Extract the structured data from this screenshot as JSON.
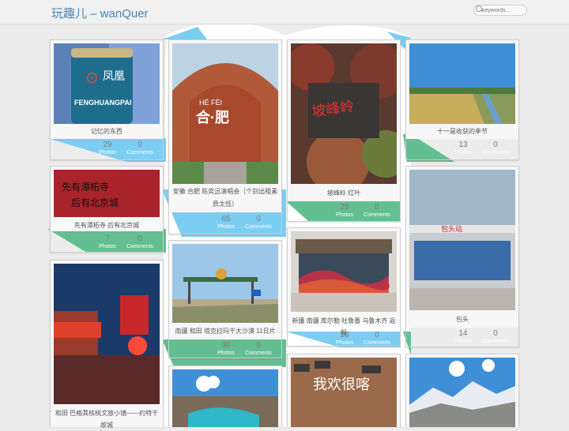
{
  "site": {
    "title": "玩趣儿 – wanQuer",
    "search_placeholder": "keywords..."
  },
  "albums": [
    {
      "caption": "记忆的东西",
      "photos": "29",
      "comments": "0",
      "photos_label": "Photos",
      "comments_label": "Comments",
      "photo_sign": "FENGHUANGPAI"
    },
    {
      "caption": "安徽 合肥 陈奕迅演唱会（个别出租素质太低）",
      "photos": "65",
      "comments": "0",
      "photos_label": "Photos",
      "comments_label": "Comments",
      "photo_sign_top": "HÉ  FÉI",
      "photo_sign": "合·肥"
    },
    {
      "caption": "坡峰岭 红叶",
      "photos": "25",
      "comments": "0",
      "photos_label": "Photos",
      "comments_label": "Comments",
      "photo_sign": "坡峰岭"
    },
    {
      "caption": "十一是收获的季节",
      "photos": "13",
      "comments": "0",
      "photos_label": "Photos",
      "comments_label": "Comments"
    },
    {
      "caption": "先有潭柘寺 后有北京城",
      "photos": "7",
      "comments": "0",
      "photos_label": "Photos",
      "comments_label": "Comments",
      "photo_sign_top": "先有潭柘寺",
      "photo_sign": "后有北京城"
    },
    {
      "caption": "南疆 和田 塔克拉玛干大沙漠 11日片",
      "photos": "30",
      "comments": "0",
      "photos_label": "Photos",
      "comments_label": "Comments"
    },
    {
      "caption": "新疆 南疆 库尔勒 吐鲁番 乌鲁木齐 返程",
      "photos": "26",
      "comments": "0",
      "photos_label": "Photos",
      "comments_label": "Comments"
    },
    {
      "caption": "包头",
      "photos": "14",
      "comments": "0",
      "photos_label": "Photos",
      "comments_label": "Comments",
      "photo_sign": "包头站"
    },
    {
      "caption": "和田 巴格其核桃文旅小镇——约特干故城",
      "photos": "",
      "comments": "",
      "photos_label": "",
      "comments_label": ""
    },
    {
      "caption": "",
      "photos": "",
      "comments": "",
      "photos_label": "",
      "comments_label": ""
    },
    {
      "caption": "",
      "photos": "",
      "comments": "",
      "photos_label": "",
      "comments_label": "",
      "photo_sign": "我欢很喀"
    },
    {
      "caption": "",
      "photos": "",
      "comments": "",
      "photos_label": "",
      "comments_label": ""
    }
  ],
  "colors": {
    "sky_blue": "#7ccdf2",
    "teal_green": "#63bf91",
    "title_blue": "#4a86b0"
  }
}
